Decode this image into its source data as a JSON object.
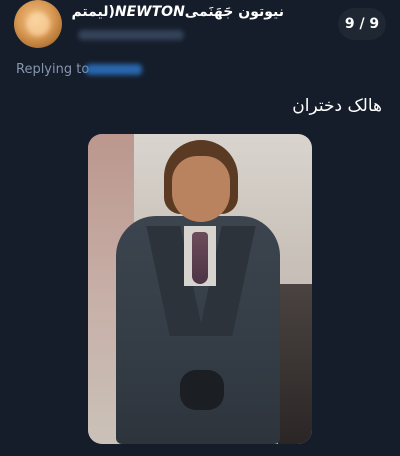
{
  "tweet": {
    "display_name_prefix": "(ليمتم ",
    "display_name_en": "NEWTON",
    "display_name_suffix": "نیوتون جَهَنَمی",
    "counter": "9 / 9",
    "replying_label": "Replying to",
    "text": "هالک دختران"
  },
  "colors": {
    "background": "#151d2b",
    "muted_text": "#8595ad",
    "mention_blue": "#2f7fd8"
  }
}
